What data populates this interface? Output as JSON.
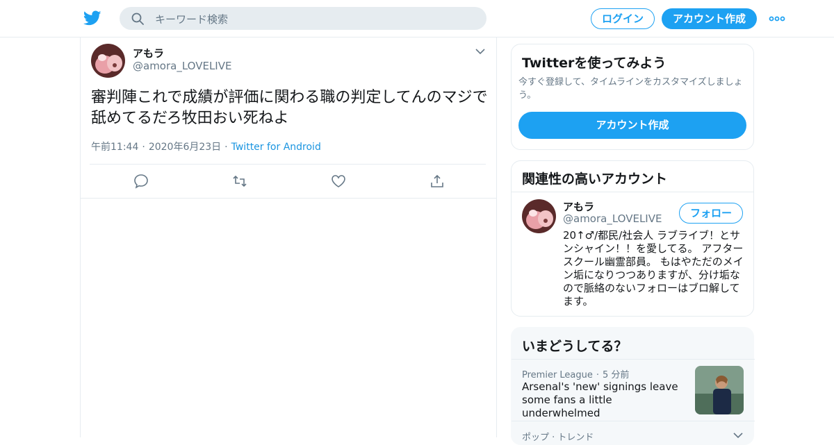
{
  "header": {
    "logo_icon": "twitter-bird-icon",
    "search_placeholder": "キーワード検索",
    "login_label": "ログイン",
    "signup_label": "アカウント作成",
    "more_icon": "more-dots-icon"
  },
  "tweet": {
    "display_name": "アもラ",
    "handle": "@amora_LOVELIVE",
    "text": "審判陣これで成績が評価に関わる職の判定してんのマジで舐めてるだろ牧田おい死ねよ",
    "time": "午前11:44",
    "date": "2020年6月23日",
    "source": "Twitter for Android",
    "actions": [
      "reply-icon",
      "retweet-icon",
      "like-icon",
      "share-icon"
    ]
  },
  "signup_card": {
    "title": "Twitterを使ってみよう",
    "description": "今すぐ登録して、タイムラインをカスタマイズしましょう。",
    "button": "アカウント作成"
  },
  "related_card": {
    "title": "関連性の高いアカウント",
    "name": "アもラ",
    "handle": "@amora_LOVELIVE",
    "follow_label": "フォロー",
    "bio": "20↑♂/都民/社会人 ラブライブ！とサンシャイン！！を愛してる。 アフタースクール幽霊部員。 もはやただのメイン垢になりつつありますが、分け垢なので脈絡のないフォローはブロ解してます。"
  },
  "trends_card": {
    "title": "いまどうしてる？",
    "item1_category": "Premier League",
    "item1_time": "5 分前",
    "item1_headline": "Arsenal's 'new' signings leave some fans a little underwhelmed",
    "item2_category": "ポップ · トレンド"
  },
  "colors": {
    "accent": "#1da1f2",
    "border": "#e6ecf0",
    "muted": "#657786"
  }
}
